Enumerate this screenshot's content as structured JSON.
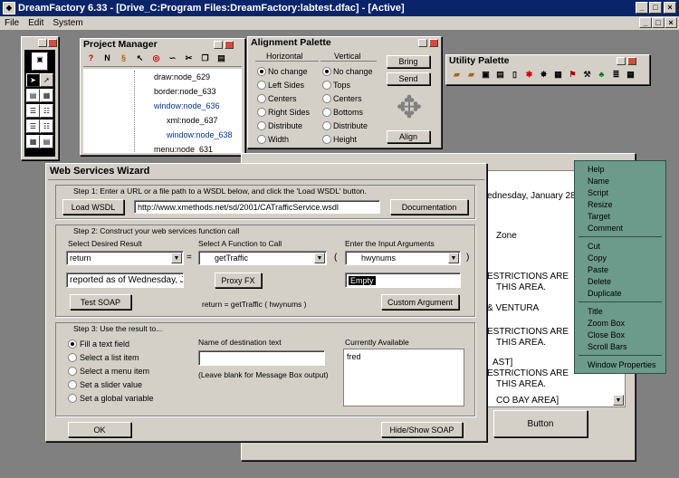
{
  "app": {
    "title": "DreamFactory 6.33 - [Drive_C:Program Files:DreamFactory:labtest.dfac] - [Active]",
    "icon_name": "dreamfactory-app-icon",
    "menu": [
      "File",
      "Edit",
      "System"
    ]
  },
  "project_manager": {
    "title": "Project Manager",
    "toolbar_icons": [
      "help-icon",
      "new-icon",
      "script-icon",
      "pointer-icon",
      "target-icon",
      "link-icon",
      "cut-icon",
      "copy-icon",
      "paste-icon"
    ],
    "tree": [
      "draw:node_629",
      "border:node_633",
      "window:node_636",
      "xml:node_637",
      "window:node_638",
      "menu:node_631"
    ]
  },
  "alignment_palette": {
    "title": "Alignment Palette",
    "horizontal_label": "Horizontal",
    "vertical_label": "Vertical",
    "horizontal": [
      "No change",
      "Left Sides",
      "Centers",
      "Right Sides",
      "Distribute",
      "Width"
    ],
    "vertical": [
      "No change",
      "Tops",
      "Centers",
      "Bottoms",
      "Distribute",
      "Height"
    ],
    "bring": "Bring",
    "send": "Send",
    "align": "Align"
  },
  "utility_palette": {
    "title": "Utility Palette"
  },
  "background_text": [
    "ednesday, January 28,",
    "Zone",
    "ESTRICTIONS ARE",
    "THIS AREA.",
    "& VENTURA",
    "ESTRICTIONS ARE",
    "THIS AREA.",
    "AST]",
    "ESTRICTIONS ARE",
    "THIS AREA.",
    "CO BAY AREA]"
  ],
  "background_button": "Button",
  "context_menu": {
    "group1": [
      "Help",
      "Name",
      "Script",
      "Resize",
      "Target",
      "Comment"
    ],
    "group2": [
      "Cut",
      "Copy",
      "Paste",
      "Delete",
      "Duplicate"
    ],
    "group3": [
      "Title",
      "Zoom Box",
      "Close Box",
      "Scroll Bars"
    ],
    "group4": [
      "Window Properties"
    ]
  },
  "wizard": {
    "title": "Web Services Wizard",
    "step1": "Step 1: Enter a URL or a file path to a WSDL below, and click the 'Load WSDL' button.",
    "load_wsdl": "Load WSDL",
    "wsdl_url": "http://www.xmethods.net/sd/2001/CATrafficService.wsdl",
    "documentation": "Documentation",
    "step2": "Step 2: Construct your web services function call",
    "select_result_label": "Select Desired Result",
    "select_function_label": "Select A Function to Call",
    "input_args_label": "Enter the Input Arguments",
    "result_value": "return",
    "equals": "=",
    "function_value": "getTraffic",
    "paren_open": "(",
    "paren_close": ")",
    "arg_value": "hwynums",
    "result_text": "reported as of Wednesday, Ja",
    "proxy_fx": "Proxy FX",
    "arg_input": "Empty",
    "test_soap": "Test SOAP",
    "call_expression": "return = getTraffic ( hwynums )",
    "custom_argument": "Custom Argument",
    "step3": "Step 3: Use the result to...",
    "options": [
      "Fill a text field",
      "Select a list item",
      "Select a menu item",
      "Set a slider value",
      "Set a global variable"
    ],
    "dest_label": "Name of destination text",
    "dest_value": "",
    "dest_hint": "(Leave blank for Message Box output)",
    "available_label": "Currently Available",
    "available_items": [
      "fred"
    ],
    "ok": "OK",
    "hide_show_soap": "Hide/Show SOAP"
  }
}
